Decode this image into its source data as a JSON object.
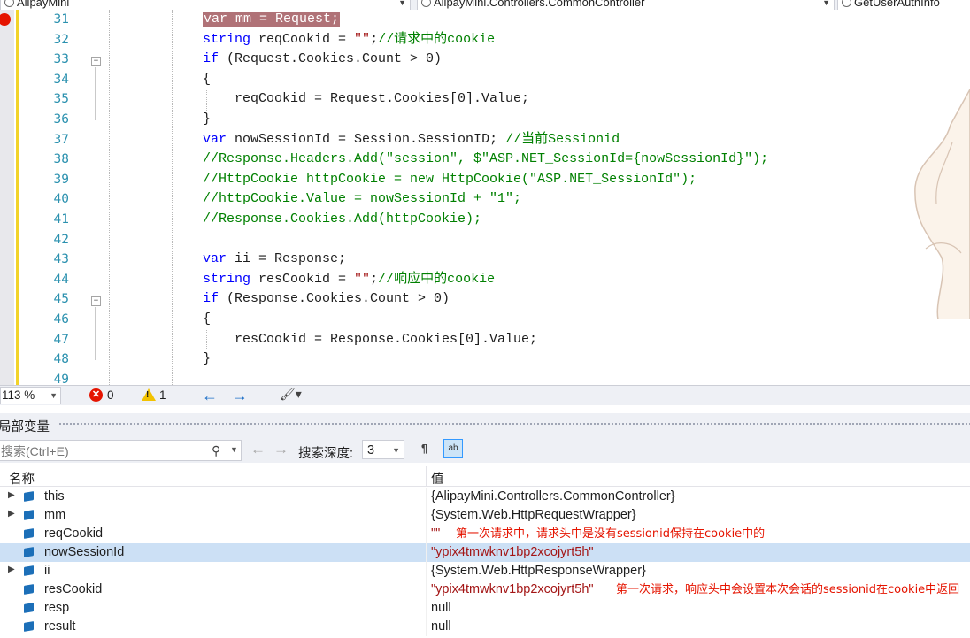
{
  "topbar": {
    "project_dropdown": "AlipayMini",
    "class_dropdown": "AlipayMini.Controllers.CommonController",
    "member_dropdown": "GetUserAuthInfo"
  },
  "editor": {
    "lines": [
      {
        "num": "31",
        "text": "var mm = Request;"
      },
      {
        "num": "32",
        "text": "string reqCookid = \"\";//请求中的cookie"
      },
      {
        "num": "33",
        "text": "if (Request.Cookies.Count > 0)"
      },
      {
        "num": "34",
        "text": "{"
      },
      {
        "num": "35",
        "text": "reqCookid = Request.Cookies[0].Value;"
      },
      {
        "num": "36",
        "text": "}"
      },
      {
        "num": "37",
        "text": "var nowSessionId = Session.SessionID; //当前Sessionid"
      },
      {
        "num": "38",
        "text": "//Response.Headers.Add(\"session\", $\"ASP.NET_SessionId={nowSessionId}\");"
      },
      {
        "num": "39",
        "text": "//HttpCookie httpCookie = new HttpCookie(\"ASP.NET_SessionId\");"
      },
      {
        "num": "40",
        "text": "//httpCookie.Value = nowSessionId + \"1\";"
      },
      {
        "num": "41",
        "text": "//Response.Cookies.Add(httpCookie);"
      },
      {
        "num": "42",
        "text": ""
      },
      {
        "num": "43",
        "text": "var ii = Response;"
      },
      {
        "num": "44",
        "text": "string resCookid = \"\";//响应中的cookie"
      },
      {
        "num": "45",
        "text": "if (Response.Cookies.Count > 0)"
      },
      {
        "num": "46",
        "text": "{"
      },
      {
        "num": "47",
        "text": "resCookid = Response.Cookies[0].Value;"
      },
      {
        "num": "48",
        "text": "}"
      },
      {
        "num": "49",
        "text": ""
      }
    ]
  },
  "status": {
    "zoom": "113 %",
    "errors": "0",
    "warnings": "1"
  },
  "locals": {
    "title": "局部变量",
    "search_placeholder": "搜索(Ctrl+E)",
    "depth_label": "搜索深度:",
    "depth_value": "3",
    "col_name": "名称",
    "col_value": "值",
    "rows": [
      {
        "name": "this",
        "value": "{AlipayMini.Controllers.CommonController}",
        "expandable": true,
        "is_string": false,
        "note": ""
      },
      {
        "name": "mm",
        "value": "{System.Web.HttpRequestWrapper}",
        "expandable": true,
        "is_string": false,
        "note": ""
      },
      {
        "name": "reqCookid",
        "value": "\"\"",
        "expandable": false,
        "is_string": true,
        "note": "第一次请求中，请求头中是没有sessionid保持在cookie中的"
      },
      {
        "name": "nowSessionId",
        "value": "\"ypix4tmwknv1bp2xcojyrt5h\"",
        "expandable": false,
        "is_string": true,
        "note": "",
        "selected": true
      },
      {
        "name": "ii",
        "value": "{System.Web.HttpResponseWrapper}",
        "expandable": true,
        "is_string": false,
        "note": ""
      },
      {
        "name": "resCookid",
        "value": "\"ypix4tmwknv1bp2xcojyrt5h\"",
        "expandable": false,
        "is_string": true,
        "note": "第一次请求，响应头中会设置本次会话的sessionid在cookie中返回"
      },
      {
        "name": "resp",
        "value": "null",
        "expandable": false,
        "is_string": false,
        "note": ""
      },
      {
        "name": "result",
        "value": "null",
        "expandable": false,
        "is_string": false,
        "note": ""
      }
    ]
  },
  "colors": {
    "breakpoint": "#e51400",
    "breakpoint_highlight": "#b07277",
    "keyword": "#0000ff",
    "comment": "#008000",
    "string": "#a31515",
    "line_number": "#2b91af"
  }
}
